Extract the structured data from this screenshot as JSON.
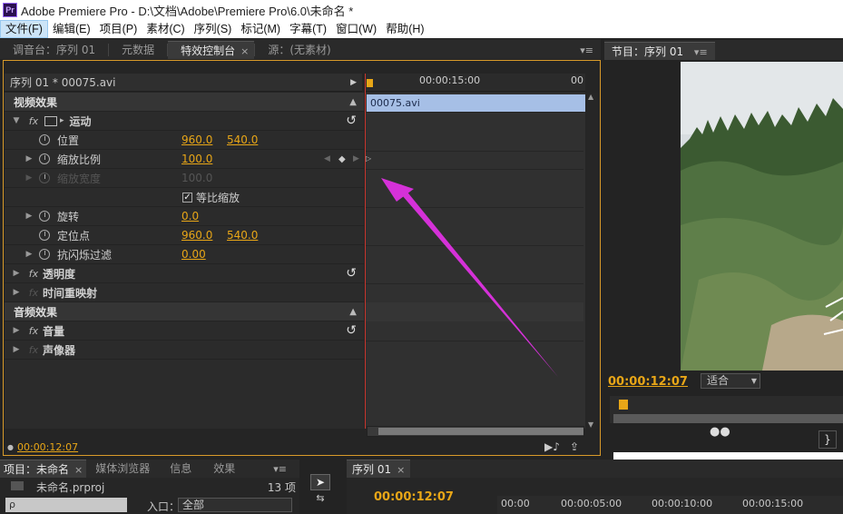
{
  "window": {
    "app_icon": "Pr",
    "title": "Adobe Premiere Pro - D:\\文档\\Adobe\\Premiere Pro\\6.0\\未命名 *"
  },
  "menu": [
    "文件(F)",
    "编辑(E)",
    "项目(P)",
    "素材(C)",
    "序列(S)",
    "标记(M)",
    "字幕(T)",
    "窗口(W)",
    "帮助(H)"
  ],
  "left_tabs": [
    "调音台：序列 01",
    "元数据",
    "特效控制台",
    "源：(无素材)"
  ],
  "ec": {
    "clip_title": "序列 01 * 00075.avi",
    "video_effects": "视频效果",
    "motion": "运动",
    "position": "位置",
    "position_x": "960.0",
    "position_y": "540.0",
    "scale": "缩放比例",
    "scale_val": "100.0",
    "scale_width": "缩放宽度",
    "scale_width_val": "100.0",
    "uniform": "等比缩放",
    "rotation": "旋转",
    "rotation_val": "0.0",
    "anchor": "定位点",
    "anchor_x": "960.0",
    "anchor_y": "540.0",
    "flicker": "抗闪烁过滤",
    "flicker_val": "0.00",
    "opacity": "透明度",
    "time_remap": "时间重映射",
    "audio_effects": "音频效果",
    "volume": "音量",
    "panner": "声像器",
    "ruler_time": "00:00:15:00",
    "ruler_end": "00",
    "clip_name": "00075.avi",
    "current_time": "00:00:12:07"
  },
  "program": {
    "tab": "节目：序列 01",
    "timecode": "00:00:12:07",
    "fit": "适合"
  },
  "project": {
    "tabs": [
      "项目：未命名",
      "媒体浏览器",
      "信息",
      "效果"
    ],
    "file": "未命名.prproj",
    "count": "13 项",
    "search_placeholder": "ρ",
    "in_label": "入口：",
    "in_value": "全部"
  },
  "sequence": {
    "tab": "序列 01",
    "timecode": "00:00:12:07",
    "ruler": [
      "00:00",
      "00:00:05:00",
      "00:00:10:00",
      "00:00:15:00"
    ]
  },
  "colors": {
    "accent": "#e8a617",
    "highlight_panel": "#d89a2a",
    "arrow": "#d531d8",
    "clip": "#a6bfe6"
  }
}
